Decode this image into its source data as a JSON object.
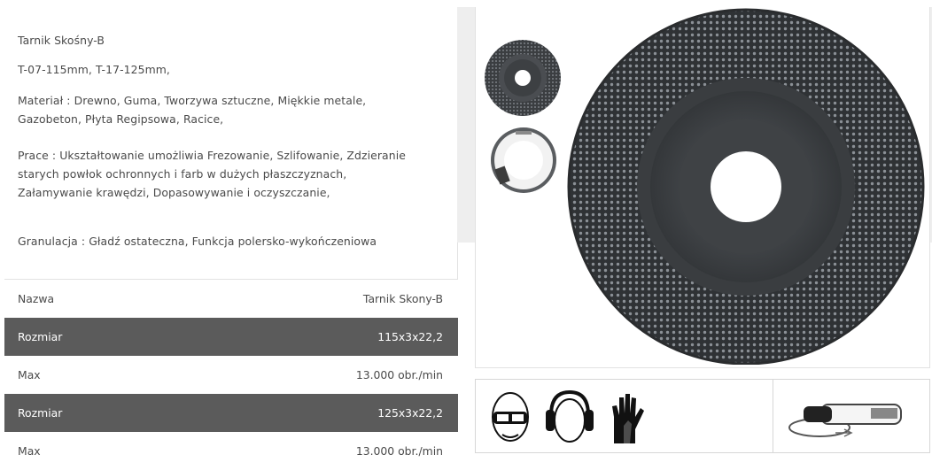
{
  "description": {
    "title": "Tarnik Skośny-B",
    "models": "T-07-115mm, T-17-125mm,",
    "material_line1": "Materiał : Drewno, Guma, Tworzywa sztuczne, Miękkie metale,",
    "material_line2": "Gazobeton, Płyta Regipsowa, Racice,",
    "work_line1": "Prace : Ukształtowanie umożliwia Frezowanie, Szlifowanie, Zdzieranie",
    "work_line2": "starych powłok ochronnych i farb w dużych płaszczyznach,",
    "work_line3": "Załamywanie krawędzi, Dopasowywanie i oczyszczanie,",
    "granulation": "Granulacja : Gładź ostateczna, Funkcja polersko-wykończeniowa"
  },
  "specs": [
    {
      "label": "Nazwa",
      "value": "Tarnik Skony-B",
      "style": "light"
    },
    {
      "label": "Rozmiar",
      "value": "115x3x22,2",
      "style": "dark"
    },
    {
      "label": "Max",
      "value": "13.000 obr./min",
      "style": "light"
    },
    {
      "label": "Rozmiar",
      "value": "125x3x22,2",
      "style": "dark"
    },
    {
      "label": "Max",
      "value": "13.000 obr./min",
      "style": "light"
    }
  ],
  "icons": {
    "product_main": "rasp-disc-image",
    "thumb_front": "rasp-disc-thumbnail",
    "thumb_back": "disc-label-thumbnail",
    "goggles": "safety-goggles-icon",
    "ear": "ear-protection-icon",
    "gloves": "gloves-icon",
    "grinder": "angle-grinder-icon"
  }
}
